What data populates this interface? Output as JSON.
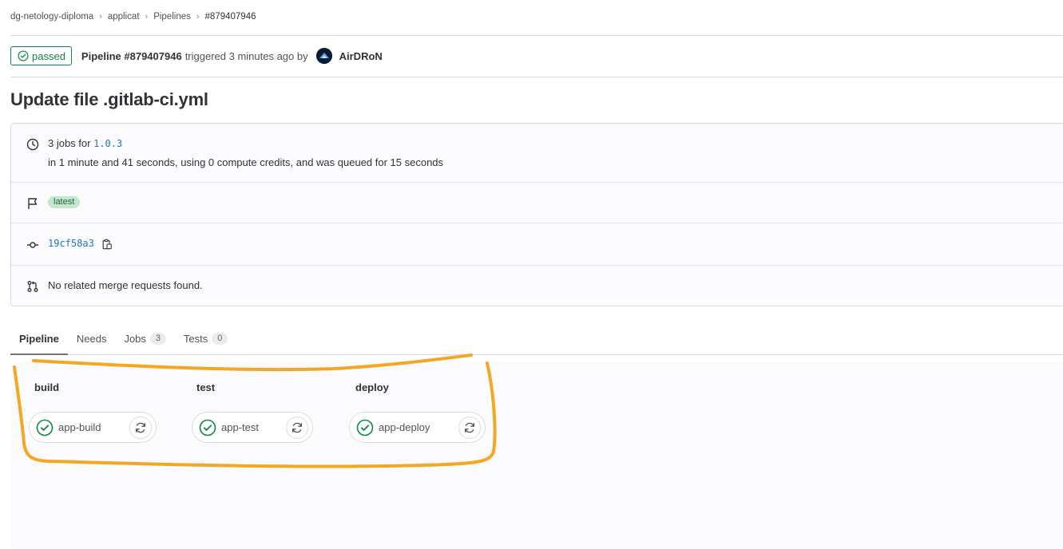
{
  "breadcrumb": {
    "items": [
      "dg-netology-diploma",
      "applicat",
      "Pipelines",
      "#879407946"
    ],
    "separator": "›"
  },
  "header": {
    "status": "passed",
    "pipeline_label": "Pipeline #879407946",
    "triggered_text": "triggered 3 minutes ago by",
    "author": "AirDRoN"
  },
  "title": "Update file .gitlab-ci.yml",
  "info": {
    "jobs_prefix": "3 jobs for",
    "ref": "1.0.3",
    "duration_text": "in 1 minute and 41 seconds, using 0 compute credits, and was queued for 15 seconds",
    "badge": "latest",
    "commit_sha": "19cf58a3",
    "merge_requests": "No related merge requests found."
  },
  "tabs": [
    {
      "label": "Pipeline",
      "count": null
    },
    {
      "label": "Needs",
      "count": null
    },
    {
      "label": "Jobs",
      "count": "3"
    },
    {
      "label": "Tests",
      "count": "0"
    }
  ],
  "stages": [
    {
      "name": "build",
      "job": "app-build",
      "status": "success"
    },
    {
      "name": "test",
      "job": "app-test",
      "status": "success"
    },
    {
      "name": "deploy",
      "job": "app-deploy",
      "status": "success"
    }
  ],
  "colors": {
    "success": "#108548",
    "link": "#1f75cb",
    "annotation": "#f5a623"
  }
}
